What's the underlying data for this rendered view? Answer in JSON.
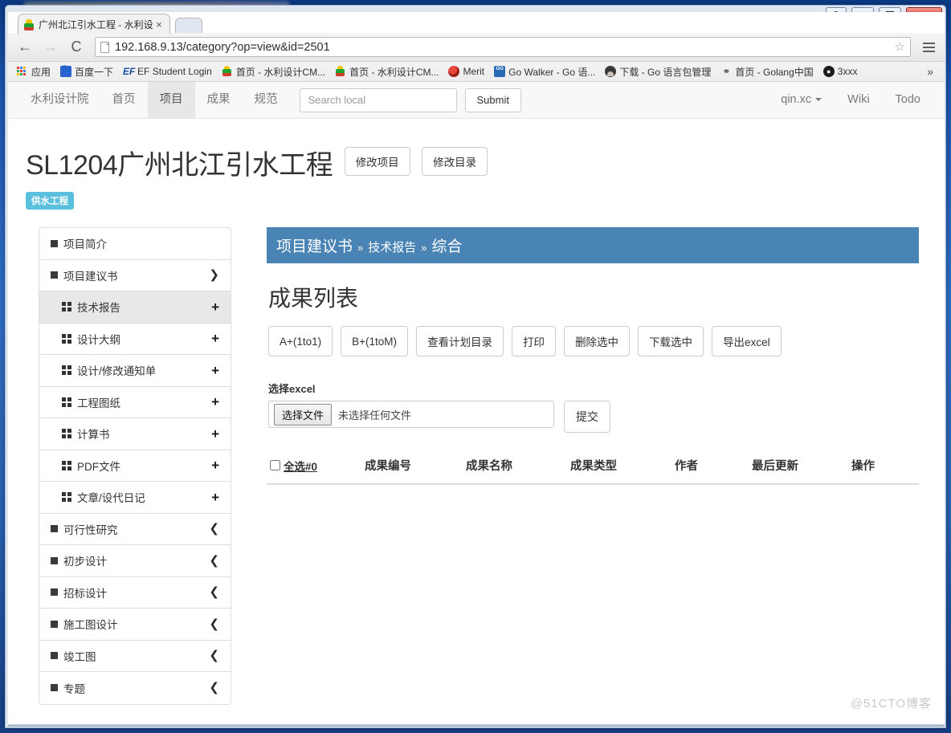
{
  "window": {
    "buttons": {
      "user": "user-account",
      "minimize": "–",
      "maximize": "□",
      "close": "x"
    }
  },
  "browser": {
    "tab": {
      "title": "广州北江引水工程 - 水利设",
      "close": "×"
    },
    "toolbar": {
      "back": "←",
      "forward": "→",
      "reload": "C",
      "url": "192.168.9.13/category?op=view&id=2501",
      "star": "☆"
    },
    "bookmarks": [
      {
        "label": "应用",
        "icon": "apps-grid-icon"
      },
      {
        "label": "百度一下",
        "icon": "baidu-icon"
      },
      {
        "label": "EF Student Login",
        "icon": "ef-icon"
      },
      {
        "label": "首页 - 水利设计CM...",
        "icon": "site-icon"
      },
      {
        "label": "首页 - 水利设计CM...",
        "icon": "site-icon"
      },
      {
        "label": "Merit",
        "icon": "merit-icon"
      },
      {
        "label": "Go Walker - Go 语...",
        "icon": "gowalker-icon"
      },
      {
        "label": "下载 - Go 语言包管理",
        "icon": "download-icon"
      },
      {
        "label": "首页 - Golang中国",
        "icon": "golang-icon"
      },
      {
        "label": "3xxx",
        "icon": "github-icon"
      }
    ],
    "overflow": "»"
  },
  "navbar": {
    "brand": "水利设计院",
    "items": [
      {
        "label": "首页",
        "active": false
      },
      {
        "label": "项目",
        "active": true
      },
      {
        "label": "成果",
        "active": false
      },
      {
        "label": "规范",
        "active": false
      }
    ],
    "search_placeholder": "Search local",
    "search_value": "",
    "submit_label": "Submit",
    "right_items": [
      {
        "label": "qin.xc",
        "has_caret": true
      },
      {
        "label": "Wiki",
        "has_caret": false
      },
      {
        "label": "Todo",
        "has_caret": false
      }
    ]
  },
  "page": {
    "title": "SL1204广州北江引水工程",
    "head_buttons": [
      "修改项目",
      "修改目录"
    ],
    "badge": "供水工程"
  },
  "sidebar": {
    "items": [
      {
        "label": "项目简介",
        "icon": "square-icon",
        "arrow": "",
        "level": "top",
        "active": false
      },
      {
        "label": "项目建议书",
        "icon": "square-icon",
        "arrow": "❯",
        "arrow_kind": "chevron-down-icon",
        "level": "top",
        "active": false
      },
      {
        "label": "技术报告",
        "icon": "grid-icon",
        "arrow": "+",
        "arrow_kind": "plus-icon",
        "level": "sub",
        "active": true
      },
      {
        "label": "设计大纲",
        "icon": "grid-icon",
        "arrow": "+",
        "arrow_kind": "plus-icon",
        "level": "sub",
        "active": false
      },
      {
        "label": "设计/修改通知单",
        "icon": "grid-icon",
        "arrow": "+",
        "arrow_kind": "plus-icon",
        "level": "sub",
        "active": false
      },
      {
        "label": "工程图纸",
        "icon": "grid-icon",
        "arrow": "+",
        "arrow_kind": "plus-icon",
        "level": "sub",
        "active": false
      },
      {
        "label": "计算书",
        "icon": "grid-icon",
        "arrow": "+",
        "arrow_kind": "plus-icon",
        "level": "sub",
        "active": false
      },
      {
        "label": "PDF文件",
        "icon": "grid-icon",
        "arrow": "+",
        "arrow_kind": "plus-icon",
        "level": "sub",
        "active": false
      },
      {
        "label": "文章/设代日记",
        "icon": "grid-icon",
        "arrow": "+",
        "arrow_kind": "plus-icon",
        "level": "sub",
        "active": false
      },
      {
        "label": "可行性研究",
        "icon": "square-icon",
        "arrow": "❮",
        "arrow_kind": "chevron-left-icon",
        "level": "top",
        "active": false
      },
      {
        "label": "初步设计",
        "icon": "square-icon",
        "arrow": "❮",
        "arrow_kind": "chevron-left-icon",
        "level": "top",
        "active": false
      },
      {
        "label": "招标设计",
        "icon": "square-icon",
        "arrow": "❮",
        "arrow_kind": "chevron-left-icon",
        "level": "top",
        "active": false
      },
      {
        "label": "施工图设计",
        "icon": "square-icon",
        "arrow": "❮",
        "arrow_kind": "chevron-left-icon",
        "level": "top",
        "active": false
      },
      {
        "label": "竣工图",
        "icon": "square-icon",
        "arrow": "❮",
        "arrow_kind": "chevron-left-icon",
        "level": "top",
        "active": false
      },
      {
        "label": "专题",
        "icon": "square-icon",
        "arrow": "❮",
        "arrow_kind": "chevron-left-icon",
        "level": "top",
        "active": false
      }
    ]
  },
  "main": {
    "breadcrumb": {
      "part1": "项目建议书",
      "sep1": "»",
      "part2": "技术报告",
      "sep2": "»",
      "part3": "综合"
    },
    "section_title": "成果列表",
    "action_buttons": [
      "A+(1to1)",
      "B+(1toM)",
      "查看计划目录",
      "打印",
      "删除选中",
      "下载选中",
      "导出excel"
    ],
    "upload": {
      "label": "选择excel",
      "choose_button": "选择文件",
      "file_name": "未选择任何文件",
      "submit_button": "提交"
    },
    "table": {
      "select_all_label": "全选#0",
      "headers": [
        "成果编号",
        "成果名称",
        "成果类型",
        "作者",
        "最后更新",
        "操作"
      ],
      "rows": []
    }
  },
  "watermark": "@51CTO博客",
  "colors": {
    "breadcrumb_bg": "#4a84b4",
    "badge_bg": "#5bc0de",
    "nav_bg": "#f8f8f8",
    "active_item_bg": "#e8e8e8",
    "close_button": "#c72a1c"
  }
}
